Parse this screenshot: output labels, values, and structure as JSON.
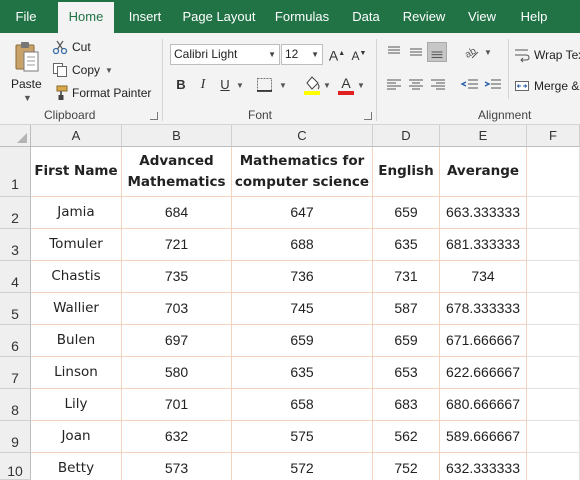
{
  "ribbon": {
    "tabs": [
      {
        "label": "File",
        "active": false
      },
      {
        "label": "Home",
        "active": true
      },
      {
        "label": "Insert",
        "active": false
      },
      {
        "label": "Page Layout",
        "active": false
      },
      {
        "label": "Formulas",
        "active": false
      },
      {
        "label": "Data",
        "active": false
      },
      {
        "label": "Review",
        "active": false
      },
      {
        "label": "View",
        "active": false
      },
      {
        "label": "Help",
        "active": false
      }
    ],
    "clipboard": {
      "group_label": "Clipboard",
      "paste_label": "Paste",
      "cut_label": "Cut",
      "copy_label": "Copy",
      "format_painter_label": "Format Painter"
    },
    "font": {
      "group_label": "Font",
      "font_name": "Calibri Light",
      "font_size": "12",
      "bold": "B",
      "italic": "I",
      "underline": "U"
    },
    "alignment": {
      "group_label": "Alignment",
      "wrap_text_label": "Wrap Tex",
      "merge_label": "Merge &"
    }
  },
  "sheet": {
    "columns": [
      "A",
      "B",
      "C",
      "D",
      "E",
      "F"
    ],
    "row_numbers": [
      "1",
      "2",
      "3",
      "4",
      "5",
      "6",
      "7",
      "8",
      "9",
      "10"
    ],
    "header": [
      "First Name",
      "Advanced Mathematics",
      "Mathematics for computer science",
      "English",
      "Averange"
    ],
    "rows": [
      [
        "Jamia",
        "684",
        "647",
        "659",
        "663.333333"
      ],
      [
        "Tomuler",
        "721",
        "688",
        "635",
        "681.333333"
      ],
      [
        "Chastis",
        "735",
        "736",
        "731",
        "734"
      ],
      [
        "Wallier",
        "703",
        "745",
        "587",
        "678.333333"
      ],
      [
        "Bulen",
        "697",
        "659",
        "659",
        "671.666667"
      ],
      [
        "Linson",
        "580",
        "635",
        "653",
        "622.666667"
      ],
      [
        "Lily",
        "701",
        "658",
        "683",
        "680.666667"
      ],
      [
        "Joan",
        "632",
        "575",
        "562",
        "589.666667"
      ],
      [
        "Betty",
        "573",
        "572",
        "752",
        "632.333333"
      ]
    ]
  },
  "colors": {
    "brand": "#217346",
    "cell_border": "#f2d3c0",
    "font_color_bar": "#e02020",
    "highlight_bar": "#ffff00"
  }
}
